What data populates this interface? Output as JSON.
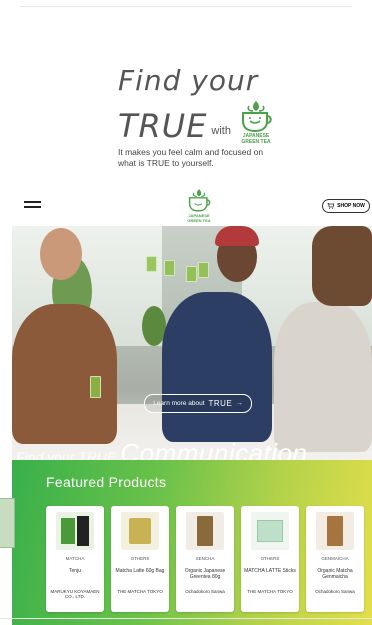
{
  "hero": {
    "line1": "Find your",
    "line2": "TRUE",
    "with": "with",
    "logo_text": "JAPANESE GREEN TEA",
    "tagline": "It makes you feel calm and focused on what is TRUE to yourself."
  },
  "nav": {
    "logo_text": "JAPANESE GREEN TEA",
    "shop_label": "SHOP NOW"
  },
  "banner": {
    "learn_prefix": "Learn more about",
    "learn_word": "TRUE",
    "learn_arrow": "→",
    "slogan_small": "Find your TRUE",
    "slogan_large": "Communication"
  },
  "featured": {
    "title": "Featured Products",
    "products": [
      {
        "category": "MATCHA",
        "name": "Tenju",
        "brand": "MARUKYU KOYAMAEN CO., LTD.",
        "color": "#5aa14a"
      },
      {
        "category": "OTHERS",
        "name": "Matcha Latte 60g Bag",
        "brand": "THE MATCHA TOKYO",
        "color": "#b7a13c"
      },
      {
        "category": "SENCHA",
        "name": "Organic Japanese Greentea 80g",
        "brand": "Ochadokoro Sanwa",
        "color": "#8a6a3a"
      },
      {
        "category": "OTHERS",
        "name": "MATCHA LATTE Sticks",
        "brand": "THE MATCHA TOKYO",
        "color": "#bfe0c8"
      },
      {
        "category": "GENMAICHA",
        "name": "Organic Matcha Genmaicha",
        "brand": "Ochadokoro Sanwa",
        "color": "#a6743e"
      }
    ]
  },
  "colors": {
    "brand_green": "#4aa24a",
    "featured_start": "#38b04a",
    "featured_end": "#e3df4a"
  }
}
